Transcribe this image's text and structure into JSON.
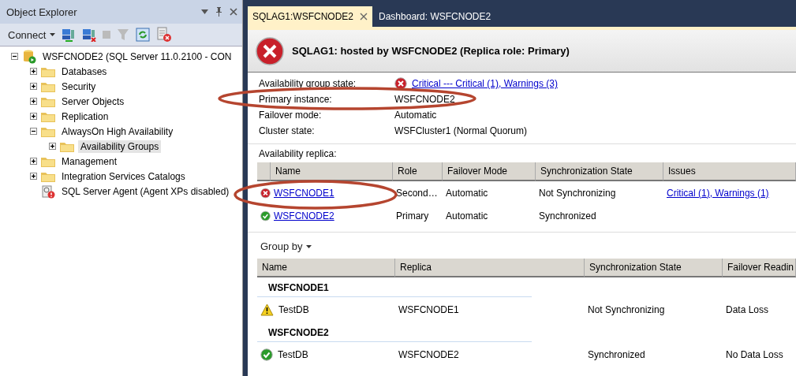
{
  "object_explorer": {
    "title": "Object Explorer",
    "connect": "Connect",
    "tree": [
      {
        "label": "WSFCNODE2 (SQL Server 11.0.2100 - CON",
        "kind": "server",
        "expanded": true,
        "selected": false,
        "children": [
          {
            "label": "Databases",
            "kind": "folder",
            "expanded": false,
            "selected": false
          },
          {
            "label": "Security",
            "kind": "folder",
            "expanded": false,
            "selected": false
          },
          {
            "label": "Server Objects",
            "kind": "folder",
            "expanded": false,
            "selected": false
          },
          {
            "label": "Replication",
            "kind": "folder",
            "expanded": false,
            "selected": false
          },
          {
            "label": "AlwaysOn High Availability",
            "kind": "folder",
            "expanded": true,
            "selected": false,
            "children": [
              {
                "label": "Availability Groups",
                "kind": "folder",
                "expanded": false,
                "selected": true
              }
            ]
          },
          {
            "label": "Management",
            "kind": "folder",
            "expanded": false,
            "selected": false
          },
          {
            "label": "Integration Services Catalogs",
            "kind": "folder",
            "expanded": false,
            "selected": false
          },
          {
            "label": "SQL Server Agent (Agent XPs disabled)",
            "kind": "agent",
            "selected": false
          }
        ]
      }
    ]
  },
  "tabs": [
    {
      "label": "SQLAG1:WSFCNODE2",
      "selected": true
    },
    {
      "label": "Dashboard: WSFCNODE2",
      "selected": false
    }
  ],
  "dashboard": {
    "kind": "error",
    "title": "SQLAG1: hosted by WSFCNODE2 (Replica role: Primary)",
    "properties": [
      {
        "label": "Availability group state:",
        "value": "Critical --- Critical (1), Warnings (3)",
        "kind": "error",
        "link": true
      },
      {
        "label": "Primary instance:",
        "value": "WSFCNODE2",
        "link": false
      },
      {
        "label": "Failover mode:",
        "value": "Automatic",
        "link": false
      },
      {
        "label": "Cluster state:",
        "value": "WSFCluster1 (Normal Quorum)",
        "link": false
      }
    ],
    "replica_label": "Availability replica:",
    "replica_columns": [
      "Name",
      "Role",
      "Failover Mode",
      "Synchronization State",
      "Issues"
    ],
    "replicas": [
      {
        "kind": "error",
        "name": "WSFCNODE1",
        "role": "Second…",
        "failover": "Automatic",
        "sync": "Not Synchronizing",
        "issues": "Critical (1), Warnings (1)"
      },
      {
        "kind": "ok",
        "name": "WSFCNODE2",
        "role": "Primary",
        "failover": "Automatic",
        "sync": "Synchronized"
      }
    ],
    "group_by": "Group by",
    "db_columns": [
      "Name",
      "Replica",
      "Synchronization State",
      "Failover Readin"
    ],
    "groups": [
      {
        "name": "WSFCNODE1",
        "rows": [
          {
            "kind": "warning",
            "name": "TestDB",
            "replica": "WSFCNODE1",
            "sync": "Not Synchronizing",
            "readiness": "Data Loss"
          }
        ]
      },
      {
        "name": "WSFCNODE2",
        "rows": [
          {
            "kind": "ok",
            "name": "TestDB",
            "replica": "WSFCNODE2",
            "sync": "Synchronized",
            "readiness": "No Data Loss"
          }
        ]
      }
    ]
  }
}
